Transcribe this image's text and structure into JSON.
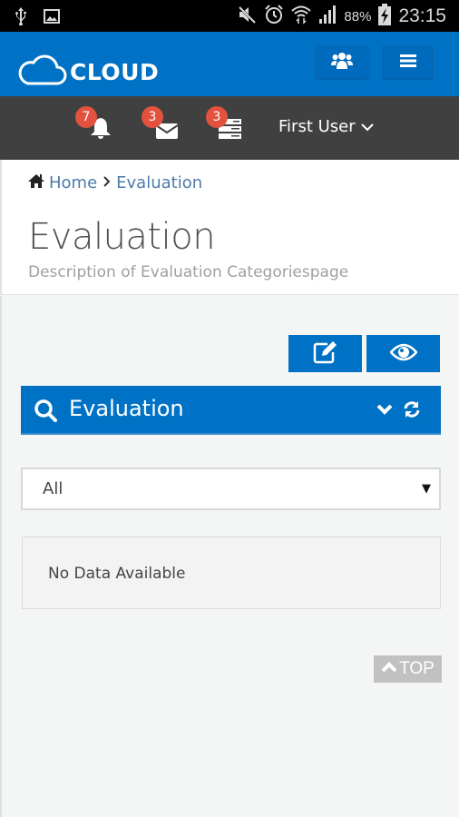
{
  "status_bar": {
    "time": "23:15",
    "battery_percent": "88%",
    "icons": [
      "usb-icon",
      "image-icon",
      "mute-icon",
      "alarm-icon",
      "wifi-icon",
      "signal-icon",
      "battery-charging-icon"
    ]
  },
  "header": {
    "logo_text": "CLOUD",
    "buttons": [
      {
        "name": "users-button",
        "icon": "users-icon"
      },
      {
        "name": "menu-button",
        "icon": "hamburger-icon"
      }
    ]
  },
  "topnav": {
    "notifications": {
      "icon": "bell-icon",
      "count": "7"
    },
    "messages": {
      "icon": "envelope-icon",
      "count": "3"
    },
    "tasks": {
      "icon": "tasks-icon",
      "count": "3"
    },
    "user_name": "First User"
  },
  "breadcrumb": {
    "home": "Home",
    "separator": ">",
    "current": "Evaluation"
  },
  "page": {
    "title": "Evaluation",
    "description": "Description of Evaluation Categoriespage"
  },
  "actions": {
    "edit_icon": "edit-icon",
    "view_icon": "eye-icon"
  },
  "panel": {
    "title": "Evaluation",
    "filter": {
      "selected": "All"
    },
    "empty_message": "No Data Available"
  },
  "back_to_top": {
    "label": "TOP"
  },
  "colors": {
    "primary": "#0072c6",
    "nav_dark": "#404040",
    "badge": "#e2523f",
    "link": "#4d7ba8",
    "top_button": "#c1c1c1"
  }
}
